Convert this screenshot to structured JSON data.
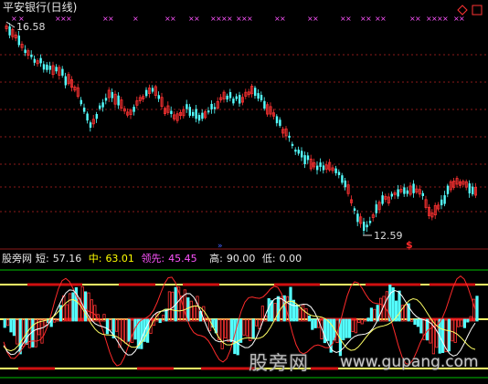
{
  "stock_title": "平安银行(日线)",
  "price_high_label": "16.58",
  "price_low_label": "12.59",
  "indicator": {
    "name": "股旁网",
    "short_label": "短:",
    "short_value": "57.16",
    "mid_label": "中:",
    "mid_value": "63.01",
    "lead_label": "领先:",
    "lead_value": "45.45",
    "high_label": "高:",
    "high_value": "90.00",
    "low_label": "低:",
    "low_value": "0.00"
  },
  "watermark": {
    "cn": "股旁网",
    "url": "www.gupang.com"
  },
  "icons": {
    "corner_diamond": "diamond-icon",
    "corner_square": "square-icon",
    "dollar_marker": "dollar-marker-icon"
  },
  "colors": {
    "up_candle": "#ff3333",
    "down_candle": "#54ffff",
    "signal_marker": "#ff55ff",
    "grid": "#8b1a1a",
    "yellow_line": "#ffff66",
    "green_line": "#00c000"
  }
}
